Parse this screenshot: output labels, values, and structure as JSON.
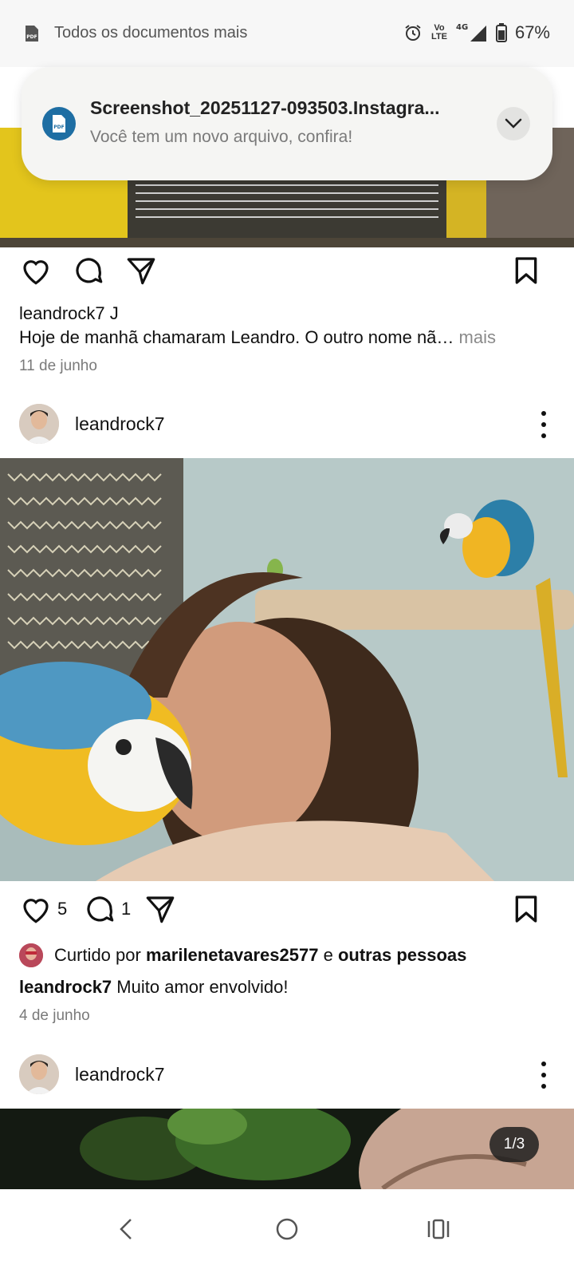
{
  "status_bar": {
    "notification_text": "Todos os documentos mais",
    "network": "4G",
    "volte": "Vo LTE",
    "battery": "67%",
    "icons": [
      "pdf-icon",
      "alarm-icon",
      "volte-icon",
      "signal-icon",
      "battery-icon"
    ]
  },
  "notification": {
    "title": "Screenshot_20251127-093503.Instagra...",
    "subtitle": "Você tem um novo arquivo, confira!",
    "icon_label": "PDF"
  },
  "post1": {
    "username": "leandrock7",
    "caption_suffix": "J",
    "caption": "Hoje de manhã chamaram Leandro. O outro nome nã…",
    "more": "mais",
    "date": "11 de junho"
  },
  "post2": {
    "username": "leandrock7",
    "likes_count": "5",
    "comments_count": "1",
    "liked_by_prefix": "Curtido por",
    "liked_by_user": "marilenetavares2577",
    "liked_by_and": "e",
    "liked_by_others": "outras pessoas",
    "caption_user": "leandrock7",
    "caption": "Muito amor envolvido!",
    "date": "4 de junho"
  },
  "post3": {
    "username": "leandrock7",
    "carousel_position": "1/3"
  },
  "colors": {
    "notif_icon": "#1e6ea3",
    "background": "#ffffff",
    "muted_text": "#7a7a7a"
  }
}
